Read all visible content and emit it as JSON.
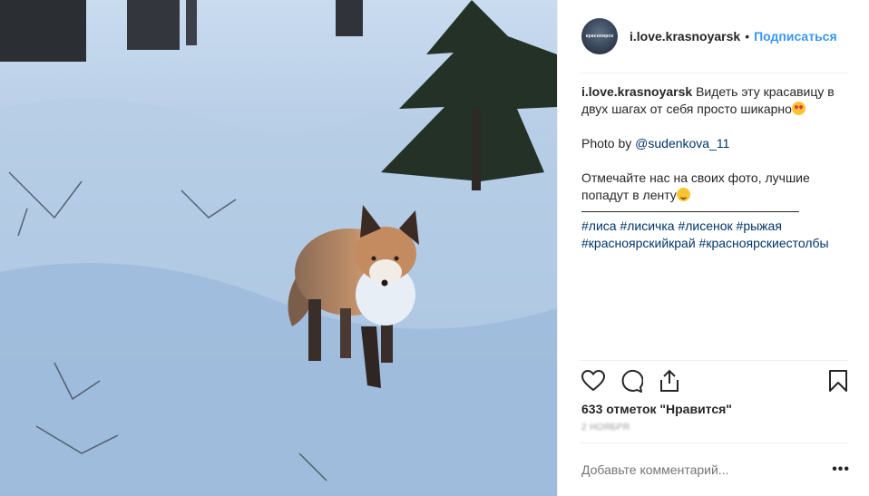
{
  "post": {
    "avatar_text": "красноярск",
    "username": "i.love.krasnoyarsk",
    "separator": "•",
    "follow_label": "Подписаться"
  },
  "caption": {
    "username": "i.love.krasnoyarsk",
    "line1": "Видеть эту красавицу в двух шагах от себя просто шикарно",
    "photo_prefix": "Photo by",
    "photo_credit": "@sudenkova_11",
    "line3": "Отмечайте нас на своих фото, лучшие попадут в ленту",
    "hashtags_line1": "#лиса #лисичка #лисенок #рыжая",
    "hashtags_line2": "#красноярскийкрай #красноярскиестолбы"
  },
  "stats": {
    "likes": "633 отметок \"Нравится\"",
    "time": "2 НОЯБРЯ"
  },
  "comment": {
    "placeholder": "Добавьте комментарий...",
    "more": "•••"
  },
  "icons": {
    "like": "heart-icon",
    "comment": "comment-icon",
    "share": "share-icon",
    "save": "bookmark-icon"
  }
}
